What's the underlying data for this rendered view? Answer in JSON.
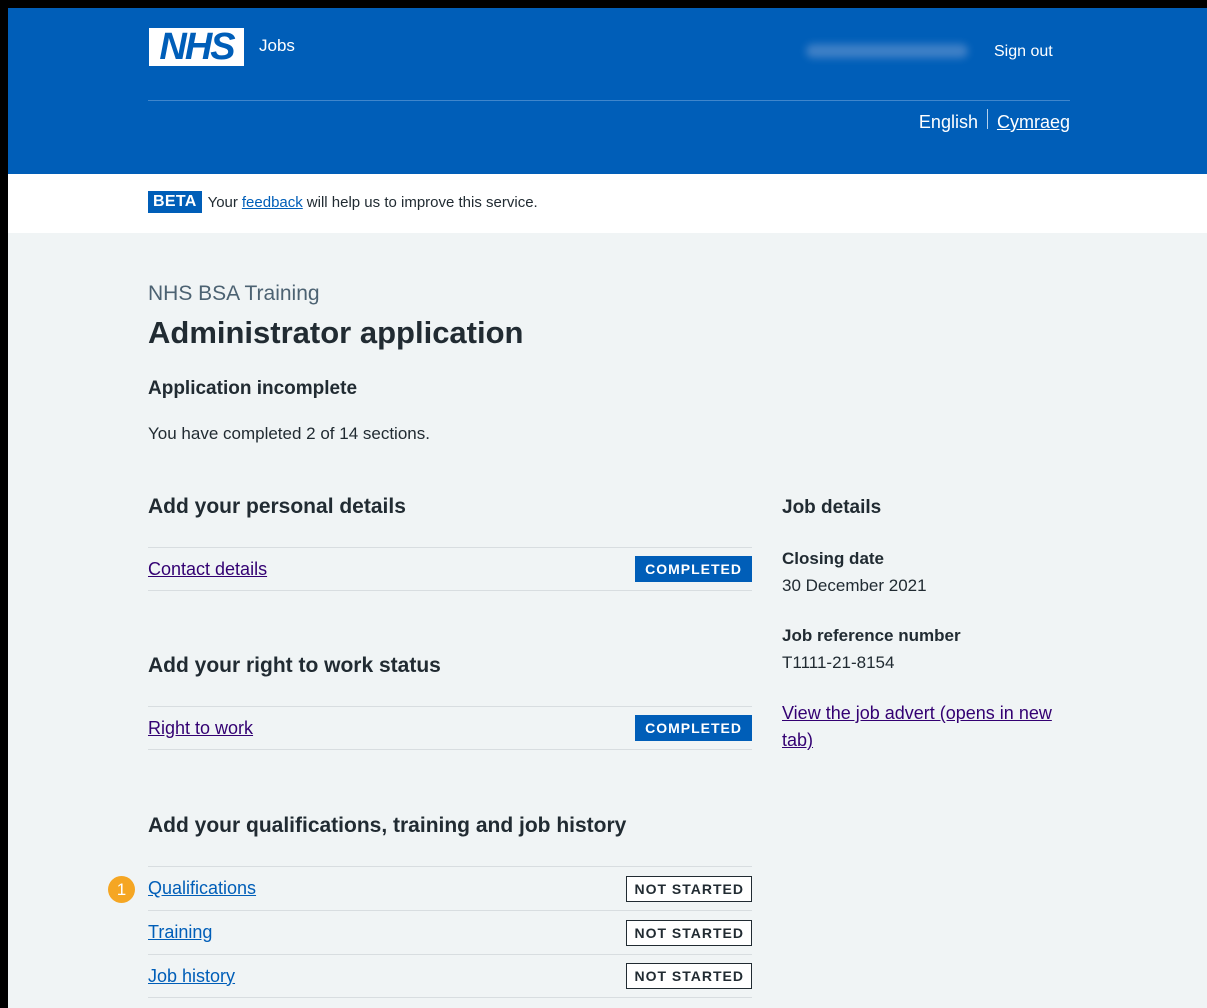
{
  "header": {
    "logo_text": "NHS",
    "service_name": "Jobs",
    "sign_out": "Sign out",
    "lang_current": "English",
    "lang_other": "Cymraeg"
  },
  "beta": {
    "tag": "BETA",
    "text_before": "Your",
    "link": "feedback",
    "text_after": "will help us to improve this service."
  },
  "page": {
    "caption": "NHS BSA Training",
    "title": "Administrator application",
    "status_title": "Application incomplete",
    "status_text": "You have completed 2 of 14 sections."
  },
  "sections": [
    {
      "heading": "Add your personal details",
      "tasks": [
        {
          "label": "Contact details",
          "status": "COMPLETED"
        }
      ]
    },
    {
      "heading": "Add your right to work status",
      "tasks": [
        {
          "label": "Right to work",
          "status": "COMPLETED"
        }
      ]
    },
    {
      "heading": "Add your qualifications, training and job history",
      "tasks": [
        {
          "label": "Qualifications",
          "status": "NOT STARTED"
        },
        {
          "label": "Training",
          "status": "NOT STARTED"
        },
        {
          "label": "Job history",
          "status": "NOT STARTED"
        }
      ]
    }
  ],
  "marker": {
    "number": "1",
    "color": "#f5a623"
  },
  "job_details": {
    "heading": "Job details",
    "closing_label": "Closing date",
    "closing_value": "30 December 2021",
    "ref_label": "Job reference number",
    "ref_value": "T1111-21-8154",
    "advert_link": "View the job advert (opens in new tab)"
  },
  "colors": {
    "brand_blue": "#005eb8",
    "page_bg": "#f0f4f5",
    "visited_link": "#330072",
    "text": "#212b32"
  }
}
